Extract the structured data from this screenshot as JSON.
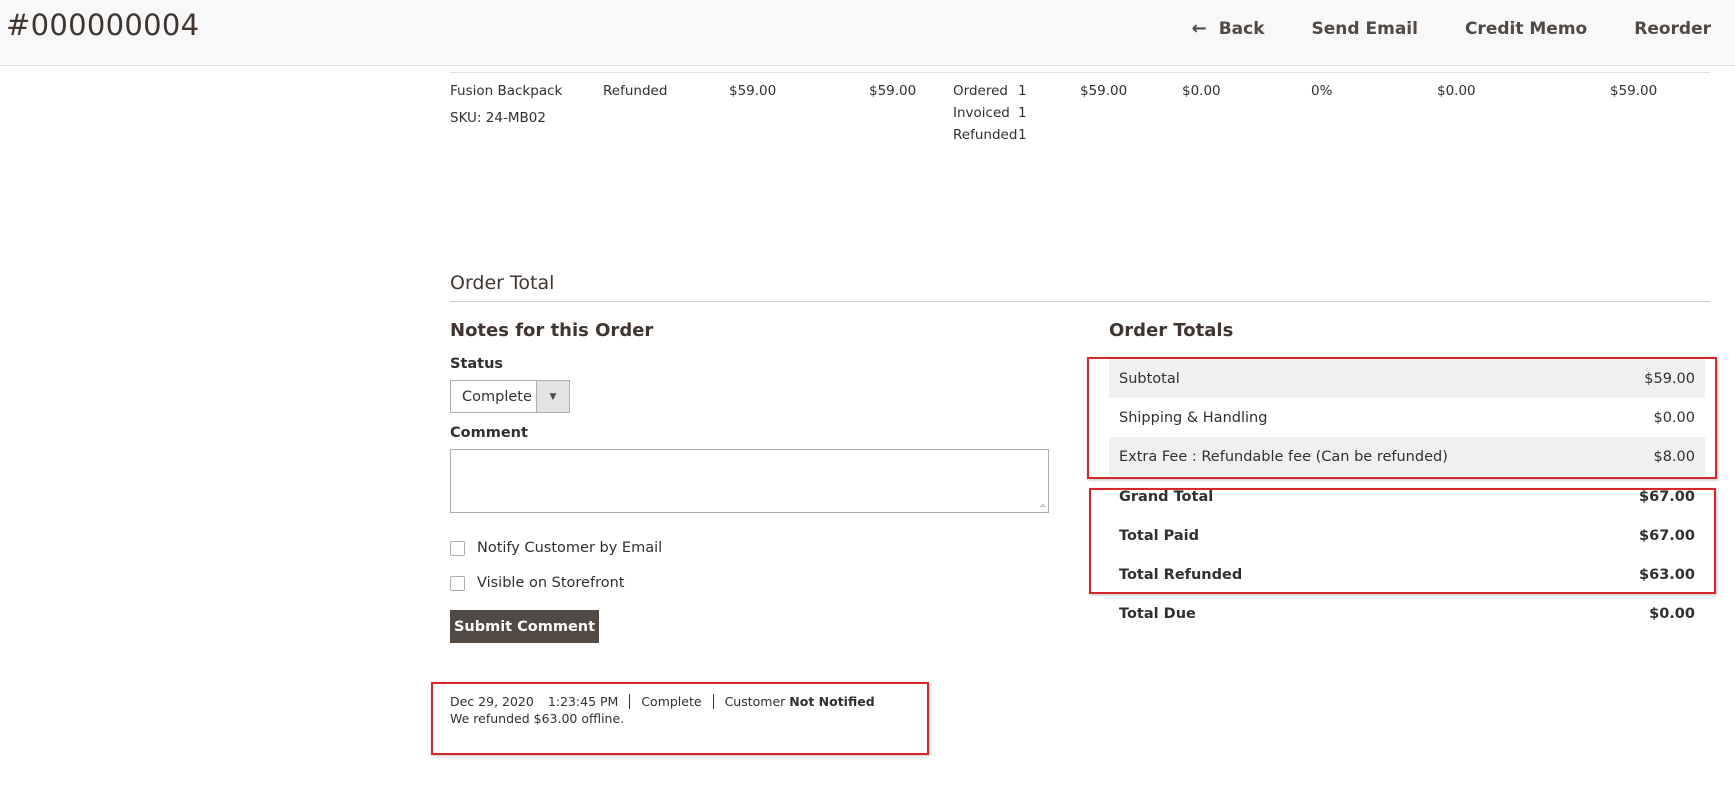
{
  "header": {
    "title": "#000000004",
    "actions": {
      "back": "Back",
      "send_email": "Send Email",
      "credit_memo": "Credit Memo",
      "reorder": "Reorder"
    }
  },
  "item": {
    "name": "Fusion Backpack",
    "sku": "SKU: 24-MB02",
    "status": "Refunded",
    "original_price": "$59.00",
    "price": "$59.00",
    "qty_labels": [
      "Ordered",
      "Invoiced",
      "Refunded"
    ],
    "qty_values": [
      "1",
      "1",
      "1"
    ],
    "subtotal": "$59.00",
    "tax_amount": "$0.00",
    "tax_percent": "0%",
    "discount": "$0.00",
    "row_total": "$59.00"
  },
  "order_total": {
    "section_title": "Order Total",
    "notes": {
      "title": "Notes for this Order",
      "status_label": "Status",
      "status_value": "Complete",
      "comment_label": "Comment",
      "notify_label": "Notify Customer by Email",
      "visible_label": "Visible on Storefront",
      "submit_label": "Submit Comment"
    },
    "history": {
      "date": "Dec 29, 2020",
      "time": "1:23:45 PM",
      "status": "Complete",
      "customer_prefix": "Customer",
      "customer_state": "Not Notified",
      "comment": "We refunded $63.00 offline."
    },
    "totals": {
      "title": "Order Totals",
      "rows": [
        {
          "label": "Subtotal",
          "value": "$59.00"
        },
        {
          "label": "Shipping & Handling",
          "value": "$0.00"
        },
        {
          "label": "Extra Fee : Refundable fee (Can be refunded)",
          "value": "$8.00"
        },
        {
          "label": "Grand Total",
          "value": "$67.00"
        },
        {
          "label": "Total Paid",
          "value": "$67.00"
        },
        {
          "label": "Total Refunded",
          "value": "$63.00"
        },
        {
          "label": "Total Due",
          "value": "$0.00"
        }
      ]
    }
  },
  "colors": {
    "highlight": "#d9262a",
    "button_bg": "#514943",
    "row_shade": "#f0f0f0"
  }
}
